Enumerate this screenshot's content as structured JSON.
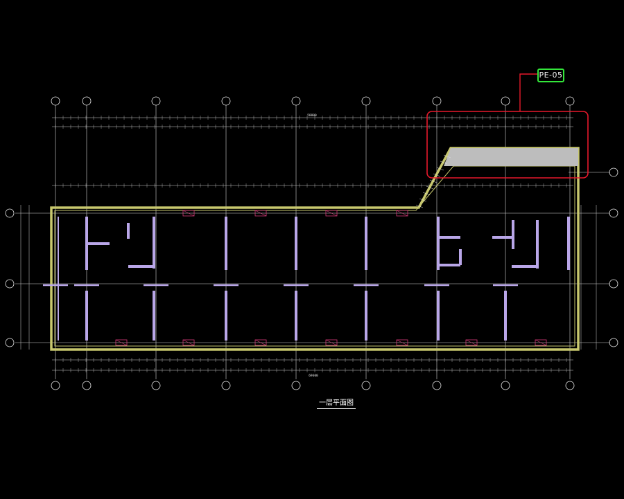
{
  "callout": {
    "label": "PE-05"
  },
  "drawing_title": "一层平面图",
  "overall_dims": {
    "top": "58800",
    "bottom": "69600"
  },
  "colors": {
    "background": "#000000",
    "wall": "#c8c86e",
    "partition": "#b9a6e8",
    "callout_frame": "#e8192c",
    "callout_tag": "#33e63a",
    "slab": "#bdbdbd",
    "column_mark": "#d83a7a"
  }
}
